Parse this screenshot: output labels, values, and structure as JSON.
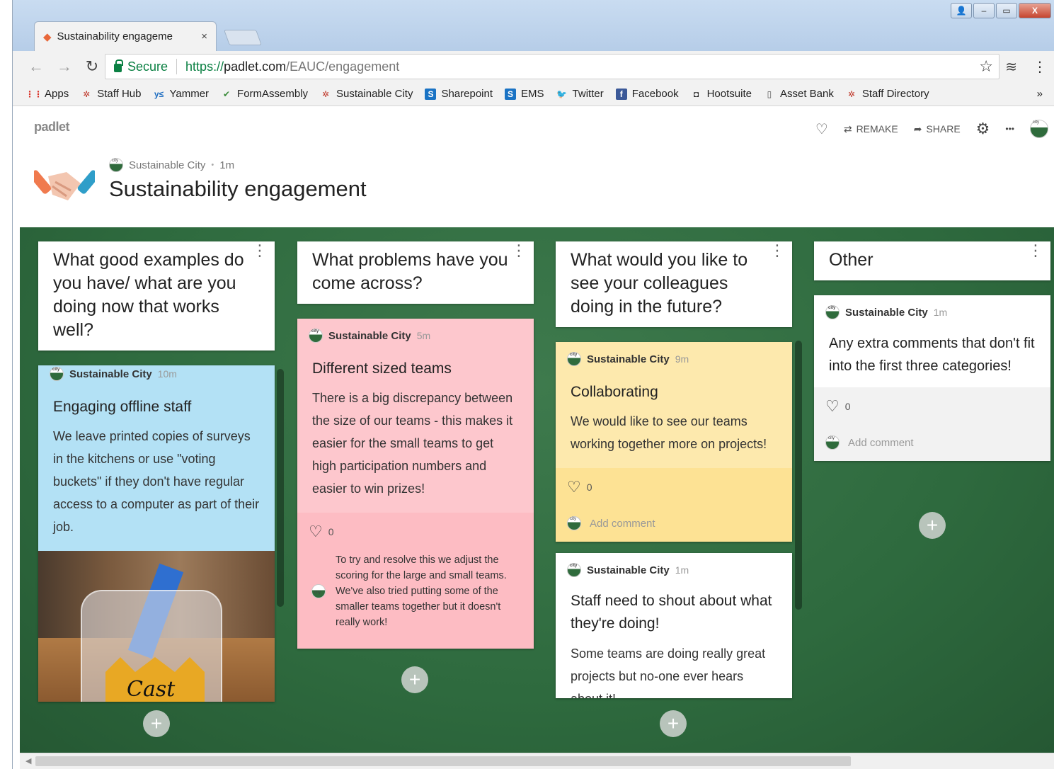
{
  "browser": {
    "tab_title": "Sustainability engageme",
    "tab_close": "×",
    "secure_label": "Secure",
    "url_scheme": "https://",
    "url_host": "padlet.com",
    "url_path": "/EAUC/engagement",
    "bookmarks": [
      {
        "label": "Apps",
        "icon": "apps-grid-icon",
        "color": "#d93025"
      },
      {
        "label": "Staff Hub",
        "icon": "city-logo-icon",
        "color": "#c0392b"
      },
      {
        "label": "Yammer",
        "icon": "yammer-icon",
        "color": "#1f6ec1"
      },
      {
        "label": "FormAssembly",
        "icon": "checkmark-icon",
        "color": "#3a8b3a"
      },
      {
        "label": "Sustainable City",
        "icon": "city-logo-icon",
        "color": "#c0392b"
      },
      {
        "label": "Sharepoint",
        "icon": "sharepoint-icon",
        "color": "#1a73c4"
      },
      {
        "label": "EMS",
        "icon": "sharepoint-icon",
        "color": "#1a73c4"
      },
      {
        "label": "Twitter",
        "icon": "twitter-icon",
        "color": "#1da1f2"
      },
      {
        "label": "Facebook",
        "icon": "facebook-icon",
        "color": "#3b5998"
      },
      {
        "label": "Hootsuite",
        "icon": "owl-icon",
        "color": "#222222"
      },
      {
        "label": "Asset Bank",
        "icon": "document-icon",
        "color": "#555555"
      },
      {
        "label": "Staff Directory",
        "icon": "city-logo-icon",
        "color": "#c0392b"
      }
    ],
    "bookmarks_more": "»"
  },
  "padlet": {
    "logo": "padlet",
    "actions": {
      "remake": "REMAKE",
      "share": "SHARE",
      "more": "•••"
    },
    "author": "Sustainable City",
    "dot": "•",
    "age": "1m",
    "title": "Sustainability engagement"
  },
  "columns": [
    {
      "heading": "What good examples do you have/ what are you doing now that works well?",
      "card": {
        "author": "Sustainable City",
        "time": "10m",
        "title": "Engaging offline staff",
        "body": "We leave printed copies of surveys in the kitchens or use \"voting buckets\" if they don't have regular access to a computer as part of their job.",
        "photo_word": "Cast",
        "color": "#b3e1f5"
      }
    },
    {
      "heading": "What problems have you come across?",
      "card": {
        "author": "Sustainable City",
        "time": "5m",
        "title": "Different sized teams",
        "body": "There is a big discrepancy between the size of our teams - this makes it easier for the small teams to get high participation numbers and easier to win prizes!",
        "likes": "0",
        "comment": "To try and resolve this we adjust the scoring for the large and small teams. We've also tried putting some of the smaller teams together but it doesn't really work!",
        "color": "#fdc7cd",
        "foot_color": "#fdbcc3"
      }
    },
    {
      "heading": "What would you like to see your colleagues doing in the future?",
      "card": {
        "author": "Sustainable City",
        "time": "9m",
        "title": "Collaborating",
        "body": "We would like to see our teams working together more on projects!",
        "likes": "0",
        "add_comment": "Add comment",
        "color": "#fde9ad",
        "foot_color": "#fde294"
      },
      "card2": {
        "author": "Sustainable City",
        "time": "1m",
        "title": "Staff need to shout about what they're doing!",
        "body": "Some teams are doing really great projects but no-one ever hears about it!"
      }
    },
    {
      "heading": "Other",
      "card": {
        "author": "Sustainable City",
        "time": "1m",
        "title": "Any extra comments that don't fit into the first three categories!",
        "likes": "0",
        "add_comment": "Add comment"
      }
    }
  ],
  "add_symbol": "+"
}
